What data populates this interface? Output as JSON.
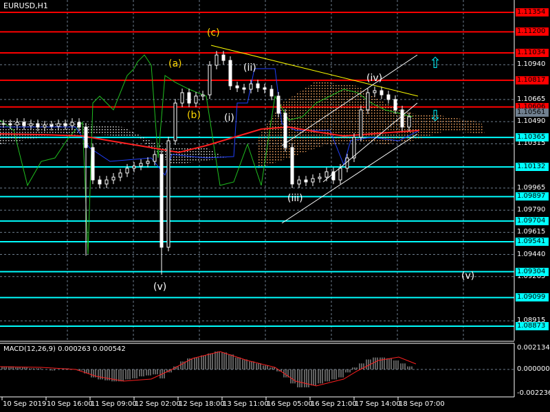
{
  "header": {
    "symbol_timeframe": "EURUSD,H1"
  },
  "colors": {
    "resistance": "#ff0000",
    "support": "#00ffff",
    "current": "#708090",
    "bull": "#ffffff",
    "bear": "#ffffff",
    "trend": "#ffff00",
    "ma": "#ff2020",
    "kijun": "#2040ff",
    "chikou": "#20c020"
  },
  "price_scale": {
    "grid_labels": [
      "1.10940",
      "1.10665",
      "1.10490",
      "1.10315",
      "1.09965",
      "1.09790",
      "1.09615",
      "1.09440",
      "1.09265",
      "1.08915"
    ],
    "resistance_levels": [
      "1.11354",
      "1.11200",
      "1.11034",
      "1.10817",
      "1.10606"
    ],
    "current_price": "1.10561",
    "support_levels": [
      "1.10365",
      "1.10132",
      "1.09897",
      "1.09704",
      "1.09541",
      "1.09304",
      "1.09099",
      "1.08873"
    ]
  },
  "time_axis": [
    "10 Sep 2019",
    "10 Sep 16:00",
    "11 Sep 09:00",
    "12 Sep 02:00",
    "12 Sep 18:00",
    "13 Sep 11:00",
    "16 Sep 05:00",
    "16 Sep 21:00",
    "17 Sep 14:00",
    "18 Sep 07:00"
  ],
  "wave_labels": {
    "a": "(a)",
    "b": "(b)",
    "c": "(c)",
    "i": "(i)",
    "ii": "(ii)",
    "iii": "(iii)",
    "iv": "(iv)",
    "v1": "(v)",
    "v2": "(v)"
  },
  "arrows": {
    "up": "⇧",
    "down": "⇩"
  },
  "macd": {
    "label": "MACD(12,26,9) 0.000263 0.000542",
    "scale": [
      "0.002134",
      "0.000000",
      "-0.002236"
    ],
    "histogram": [
      0.0003,
      0.0003,
      0.0002,
      0.0002,
      0.0001,
      0.0001,
      0.0,
      -0.0001,
      0.0,
      0.0001,
      0.0,
      -0.0001,
      -0.0004,
      -0.0008,
      -0.001,
      -0.0011,
      -0.0012,
      -0.0012,
      -0.001,
      -0.0009,
      -0.0007,
      -0.0006,
      -0.0005,
      -0.0009,
      -0.0003,
      0.0003,
      0.0008,
      0.0011,
      0.0012,
      0.0014,
      0.0016,
      0.0018,
      0.0017,
      0.0015,
      0.0012,
      0.001,
      0.0008,
      0.0006,
      0.0004,
      0.0002,
      -0.0002,
      -0.0008,
      -0.0014,
      -0.0018,
      -0.0018,
      -0.0016,
      -0.0014,
      -0.0012,
      -0.001,
      -0.0008,
      -0.0003,
      0.0002,
      0.0006,
      0.001,
      0.0012,
      0.0012,
      0.0011,
      0.0009,
      0.0006,
      0.0003
    ]
  },
  "chart_data": {
    "type": "candlestick",
    "symbol": "EURUSD",
    "timeframe": "H1",
    "closes": [
      1.10474,
      1.10464,
      1.10485,
      1.10458,
      1.10474,
      1.10447,
      1.10464,
      1.10453,
      1.10474,
      1.10458,
      1.10485,
      1.10447,
      1.10285,
      1.10029,
      1.09997,
      1.10029,
      1.10051,
      1.10084,
      1.10122,
      1.10138,
      1.1016,
      1.10176,
      1.1023,
      1.09497,
      1.10339,
      1.10637,
      1.10719,
      1.10637,
      1.10692,
      1.10702,
      1.10936,
      1.11017,
      1.10974,
      1.10773,
      1.10757,
      1.10746,
      1.10789,
      1.10757,
      1.10746,
      1.10692,
      1.10556,
      1.10285,
      1.09997,
      1.10029,
      1.10013,
      1.1004,
      1.10051,
      1.10094,
      1.10029,
      1.10122,
      1.10203,
      1.10366,
      1.10583,
      1.10719,
      1.10735,
      1.10702,
      1.10665,
      1.10583,
      1.10447,
      1.10529
    ]
  }
}
